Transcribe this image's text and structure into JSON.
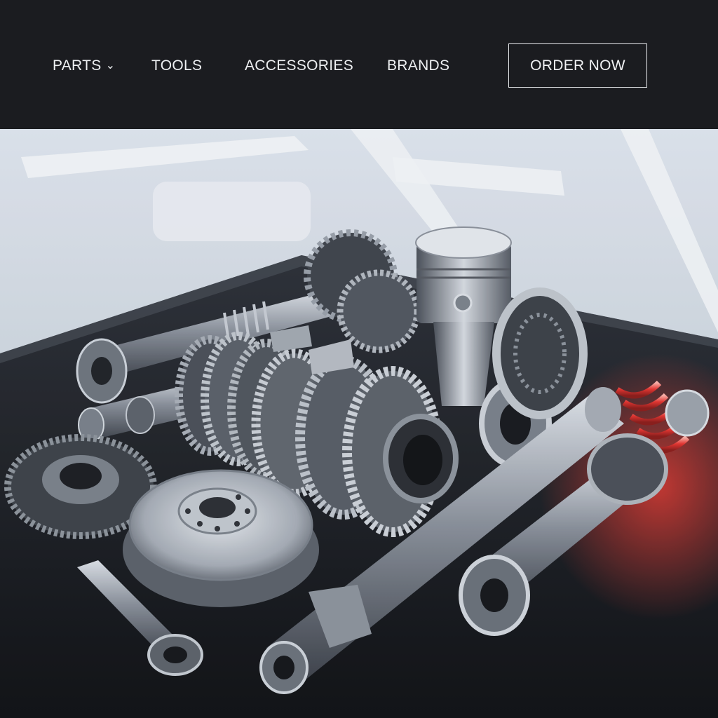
{
  "nav": {
    "items": [
      {
        "label": "PARTS",
        "has_dropdown": true
      },
      {
        "label": "TOOLS"
      },
      {
        "label": "ACCESSORIES"
      },
      {
        "label": "BRANDS"
      }
    ],
    "cta_label": "ORDER NOW"
  },
  "hero": {
    "image_subject": "automotive drivetrain parts (gears, pistons, shafts, brake rotor) on a dark workbench",
    "accent_color": "#e8322c"
  },
  "colors": {
    "topbar_bg": "#1b1c20",
    "nav_text": "#eef0f2",
    "button_border": "#e9ebee"
  }
}
